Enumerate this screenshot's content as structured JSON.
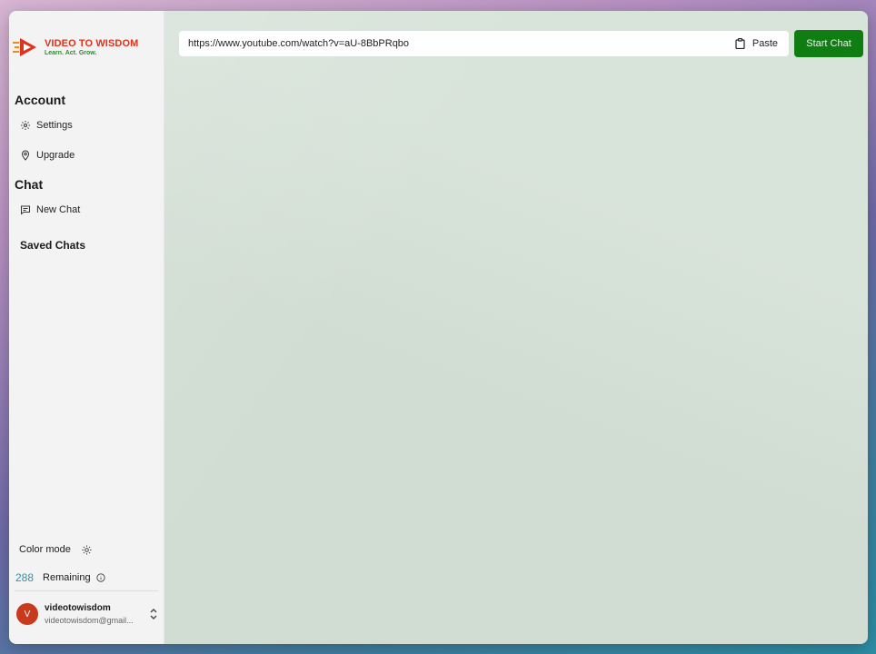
{
  "brand": {
    "title": "VIDEO TO WISDOM",
    "tagline": "Learn. Act. Grow.",
    "primary_color": "#e0321c",
    "tagline_color": "#2e8b2e"
  },
  "sidebar": {
    "account_heading": "Account",
    "account_items": [
      {
        "label": "Settings",
        "icon": "gear-icon"
      },
      {
        "label": "Upgrade",
        "icon": "badge-icon"
      }
    ],
    "chat_heading": "Chat",
    "chat_items": [
      {
        "label": "New Chat",
        "icon": "chat-icon"
      }
    ],
    "saved_heading": "Saved Chats",
    "color_mode_label": "Color mode",
    "color_mode_icon": "sun-icon",
    "remaining_count": "288",
    "remaining_label": "Remaining",
    "remaining_icon": "info-icon",
    "user": {
      "initial": "V",
      "name": "videotowisdom",
      "email": "videotowisdom@gmail...",
      "avatar_color": "#c8391e"
    }
  },
  "main": {
    "url_value": "https://www.youtube.com/watch?v=aU-8BbPRqbo",
    "paste_label": "Paste",
    "start_label": "Start Chat",
    "start_color": "#0f7d12"
  }
}
